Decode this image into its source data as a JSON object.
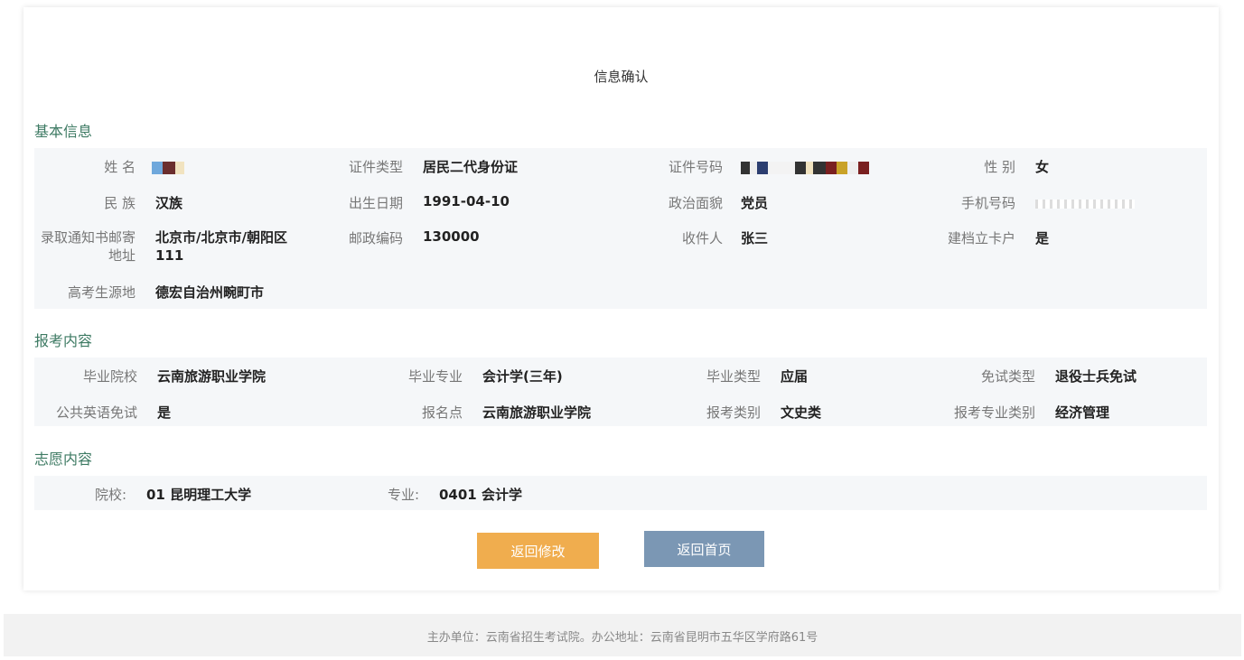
{
  "page_title": "信息确认",
  "basic": {
    "title": "基本信息",
    "name_label": "姓 名",
    "id_type_label": "证件类型",
    "id_type_value": "居民二代身份证",
    "id_no_label": "证件号码",
    "gender_label": "性 别",
    "gender_value": "女",
    "ethnic_label": "民 族",
    "ethnic_value": "汉族",
    "birth_label": "出生日期",
    "birth_value": "1991-04-10",
    "political_label": "政治面貌",
    "political_value": "党员",
    "phone_label": "手机号码",
    "address_label": "录取通知书邮寄地址",
    "address_value": "北京市/北京市/朝阳区111",
    "postcode_label": "邮政编码",
    "postcode_value": "130000",
    "recipient_label": "收件人",
    "recipient_value": "张三",
    "archive_label": "建档立卡户",
    "archive_value": "是",
    "origin_label": "高考生源地",
    "origin_value": "德宏自治州畹町市"
  },
  "exam": {
    "title": "报考内容",
    "school_label": "毕业院校",
    "school_value": "云南旅游职业学院",
    "major_label": "毕业专业",
    "major_value": "会计学(三年)",
    "grad_type_label": "毕业类型",
    "grad_type_value": "应届",
    "exempt_label": "免试类型",
    "exempt_value": "退役士兵免试",
    "english_label": "公共英语免试",
    "english_value": "是",
    "site_label": "报名点",
    "site_value": "云南旅游职业学院",
    "category_label": "报考类别",
    "category_value": "文史类",
    "major_cat_label": "报考专业类别",
    "major_cat_value": "经济管理"
  },
  "wish": {
    "title": "志愿内容",
    "college_label": "院校:",
    "college_value": "01 昆明理工大学",
    "major_label": "专业:",
    "major_value": "0401 会计学"
  },
  "buttons": {
    "edit": "返回修改",
    "home": "返回首页"
  },
  "footer": "主办单位：云南省招生考试院。办公地址：云南省昆明市五华区学府路61号",
  "colors": {
    "section_title": "#3d7a63",
    "btn_edit": "#f0ad4e",
    "btn_home": "#7b97b4"
  }
}
